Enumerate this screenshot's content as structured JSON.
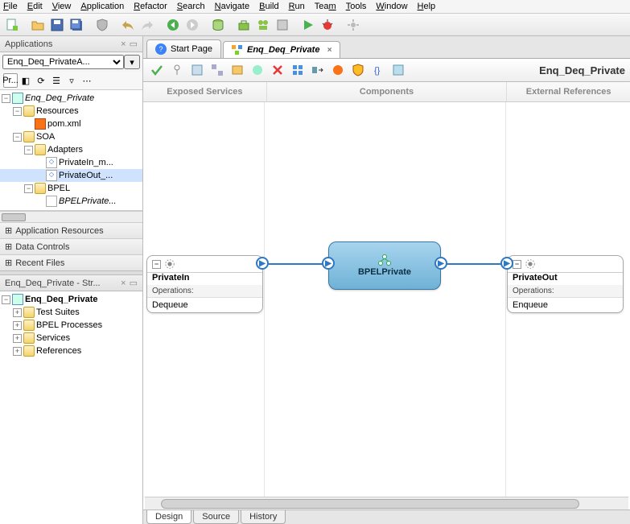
{
  "menu": [
    "File",
    "Edit",
    "View",
    "Application",
    "Refactor",
    "Search",
    "Navigate",
    "Build",
    "Run",
    "Team",
    "Tools",
    "Window",
    "Help"
  ],
  "applications_panel": {
    "title": "Applications",
    "combo_value": "Enq_Deq_PrivateA...",
    "mini_tabs": [
      "Pr..."
    ],
    "tree": {
      "root": "Enq_Deq_Private",
      "resources": "Resources",
      "pom": "pom.xml",
      "soa": "SOA",
      "adapters": "Adapters",
      "privatein": "PrivateIn_m...",
      "privateout": "PrivateOut_...",
      "bpel": "BPEL",
      "bpelprivate": "BPELPrivate..."
    },
    "accordion": [
      "Application Resources",
      "Data Controls",
      "Recent Files"
    ]
  },
  "structure_panel": {
    "title": "Enq_Deq_Private - Str...",
    "root": "Enq_Deq_Private",
    "items": [
      "Test Suites",
      "BPEL Processes",
      "Services",
      "References"
    ]
  },
  "editor": {
    "tabs": [
      {
        "label": "Start Page",
        "active": false,
        "icon": "q"
      },
      {
        "label": "Enq_Deq_Private",
        "active": true,
        "icon": "comp"
      }
    ],
    "title": "Enq_Deq_Private",
    "lanes": [
      "Exposed Services",
      "Components",
      "External References"
    ],
    "private_in": {
      "name": "PrivateIn",
      "ops_label": "Operations:",
      "op": "Dequeue"
    },
    "bpel": "BPELPrivate",
    "private_out": {
      "name": "PrivateOut",
      "ops_label": "Operations:",
      "op": "Enqueue"
    },
    "bottom_tabs": [
      "Design",
      "Source",
      "History"
    ]
  }
}
